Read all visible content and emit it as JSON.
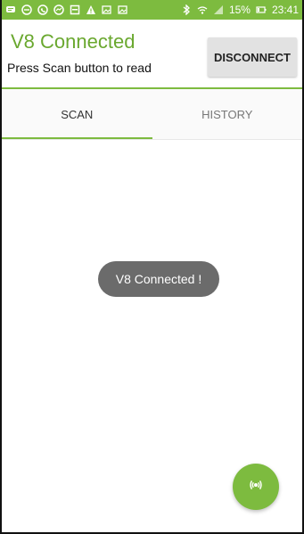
{
  "status_bar": {
    "left_icons": [
      "chat-icon",
      "minus-circle-icon",
      "whatsapp-icon",
      "messenger-icon",
      "image-icon",
      "warning-icon",
      "photo-icon",
      "photo-icon-2"
    ],
    "right_icons": [
      "bluetooth-icon",
      "wifi-icon",
      "signal-icon"
    ],
    "battery_text": "15%",
    "time": "23:41"
  },
  "header": {
    "title": "V8 Connected",
    "subtitle": "Press Scan button to read",
    "disconnect_label": "DISCONNECT"
  },
  "tabs": [
    {
      "label": "SCAN",
      "active": true
    },
    {
      "label": "HISTORY",
      "active": false
    }
  ],
  "toast": {
    "text": "V8 Connected !"
  },
  "fab": {
    "icon": "nfc-scan-icon"
  },
  "colors": {
    "accent": "#7dbb3f",
    "title": "#6aa82f",
    "toast_bg": "#6b6b6b",
    "button_bg": "#e2e2e2"
  }
}
